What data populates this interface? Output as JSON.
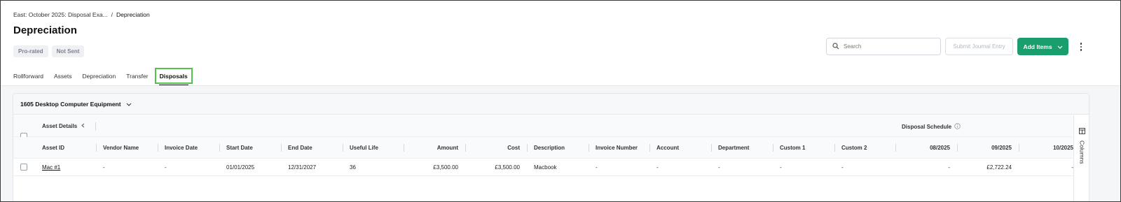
{
  "breadcrumb": {
    "parent": "East: October 2025: Disposal Exa...",
    "separator": "/",
    "current": "Depreciation"
  },
  "page": {
    "title": "Depreciation"
  },
  "badges": [
    "Pro-rated",
    "Not Sent"
  ],
  "toolbar": {
    "search_placeholder": "Search",
    "submit_label": "Submit Journal Entry",
    "add_label": "Add Items"
  },
  "tabs": [
    "Rollforward",
    "Assets",
    "Depreciation",
    "Transfer",
    "Disposals"
  ],
  "active_tab": "Disposals",
  "group": {
    "title": "1605 Desktop Computer Equipment"
  },
  "table": {
    "group_headers": {
      "asset_details": "Asset Details",
      "disposal_schedule": "Disposal Schedule"
    },
    "columns": [
      "Asset ID",
      "Vendor Name",
      "Invoice Date",
      "Start Date",
      "End Date",
      "Useful Life",
      "Amount",
      "Cost",
      "Description",
      "Invoice Number",
      "Account",
      "Department",
      "Custom 1",
      "Custom 2",
      "08/2025",
      "09/2025",
      "10/2025"
    ],
    "rows": [
      [
        "Mac #1",
        "-",
        "-",
        "01/01/2025",
        "12/31/2027",
        "36",
        "£3,500.00",
        "£3,500.00",
        "Macbook",
        "-",
        "-",
        "-",
        "-",
        "-",
        "-",
        "£2,722.24",
        "-"
      ]
    ]
  },
  "side_panel": {
    "label": "Columns"
  },
  "colors": {
    "accent": "#1a9e6e",
    "highlight": "#52c24b"
  }
}
